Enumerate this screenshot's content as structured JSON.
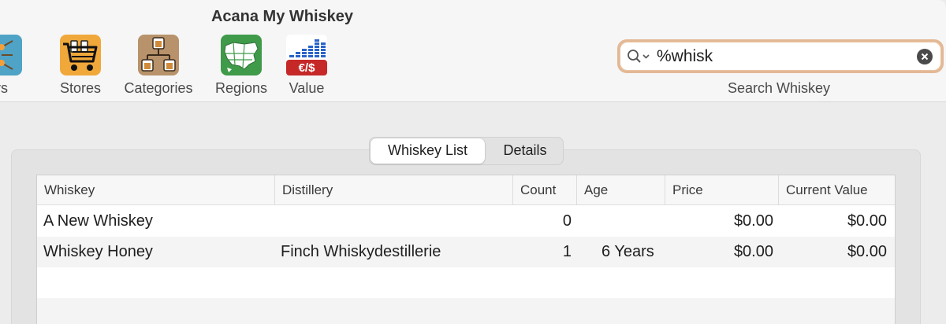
{
  "window": {
    "title": "Acana My Whiskey"
  },
  "toolbar": {
    "items": [
      {
        "label": "utors",
        "icon": "distributors-icon"
      },
      {
        "label": "Stores",
        "icon": "shopping-cart-icon"
      },
      {
        "label": "Categories",
        "icon": "categories-icon"
      },
      {
        "label": "Regions",
        "icon": "map-icon"
      },
      {
        "label": "Value",
        "icon": "value-chart-icon",
        "badge": "€/$"
      }
    ]
  },
  "search": {
    "value": "%whisk",
    "label": "Search Whiskey",
    "accent": "#e3b895"
  },
  "segments": {
    "items": [
      "Whiskey List",
      "Details"
    ],
    "selected": "Whiskey List"
  },
  "table": {
    "columns": [
      "Whiskey",
      "Distillery",
      "Count",
      "Age",
      "Price",
      "Current Value"
    ],
    "rows": [
      {
        "whiskey": "A New Whiskey",
        "distillery": "",
        "count": "0",
        "age": "",
        "price": "$0.00",
        "current_value": "$0.00"
      },
      {
        "whiskey": "Whiskey Honey",
        "distillery": "Finch Whiskydestillerie",
        "count": "1",
        "age": "6 Years",
        "price": "$0.00",
        "current_value": "$0.00"
      }
    ]
  }
}
